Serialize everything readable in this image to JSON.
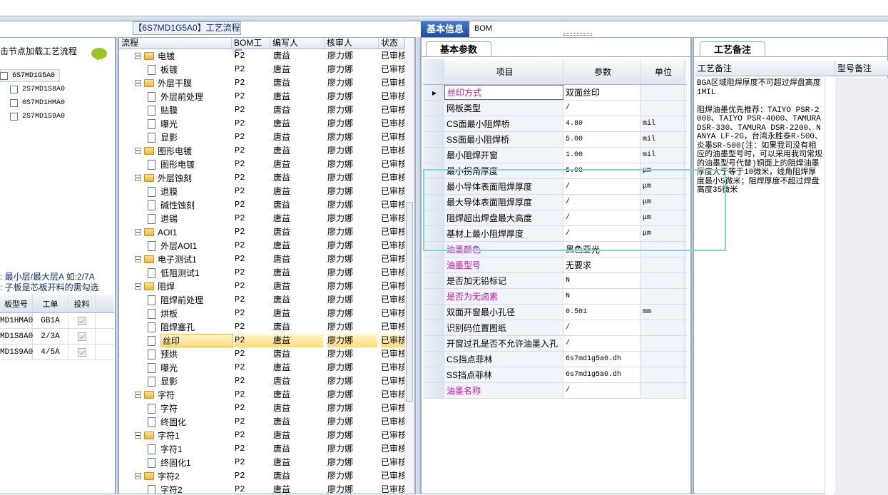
{
  "left": {
    "instruction": "击节点加载工艺流程",
    "tree": [
      "6S7MD1G5A0",
      "2S7MD1S8A0",
      "0S7MD1HMA0",
      "2S7MD1S9A0"
    ],
    "legend1": ": 最小层/最大层A 如:2/7A",
    "legend2": ": 子板是芯板开料的需勾选",
    "grid_headers": [
      "板型号",
      "工单",
      "投料"
    ],
    "grid_rows": [
      {
        "model": "MD1HMA0",
        "order": "GB1A"
      },
      {
        "model": "MD1S8A0",
        "order": "2/3A"
      },
      {
        "model": "MD1S9A0",
        "order": "4/5A"
      }
    ]
  },
  "mid": {
    "title": "【6S7MD1G5A0】工艺流程",
    "headers": [
      "流程",
      "BOM工厂",
      "编写人",
      "核审人",
      "状态"
    ],
    "rows": [
      {
        "name": "电镀",
        "type": "folder",
        "f": "P2",
        "w": "唐益",
        "r": "廖力娜",
        "s": "已审核"
      },
      {
        "name": "板镀",
        "type": "doc",
        "f": "P2",
        "w": "唐益",
        "r": "廖力娜",
        "s": "已审核"
      },
      {
        "name": "外层干膜",
        "type": "folder",
        "f": "P2",
        "w": "唐益",
        "r": "廖力娜",
        "s": "已审核"
      },
      {
        "name": "外层前处理",
        "type": "doc",
        "f": "P2",
        "w": "唐益",
        "r": "廖力娜",
        "s": "已审核"
      },
      {
        "name": "贴膜",
        "type": "doc",
        "f": "P2",
        "w": "唐益",
        "r": "廖力娜",
        "s": "已审核"
      },
      {
        "name": "曝光",
        "type": "doc",
        "f": "P2",
        "w": "唐益",
        "r": "廖力娜",
        "s": "已审核"
      },
      {
        "name": "显影",
        "type": "doc",
        "f": "P2",
        "w": "唐益",
        "r": "廖力娜",
        "s": "已审核"
      },
      {
        "name": "图形电镀",
        "type": "folder",
        "f": "P2",
        "w": "唐益",
        "r": "廖力娜",
        "s": "已审核"
      },
      {
        "name": "图形电镀",
        "type": "doc",
        "f": "P2",
        "w": "唐益",
        "r": "廖力娜",
        "s": "已审核"
      },
      {
        "name": "外层蚀刻",
        "type": "folder",
        "f": "P2",
        "w": "唐益",
        "r": "廖力娜",
        "s": "已审核"
      },
      {
        "name": "退膜",
        "type": "doc",
        "f": "P2",
        "w": "唐益",
        "r": "廖力娜",
        "s": "已审核"
      },
      {
        "name": "碱性蚀刻",
        "type": "doc",
        "f": "P2",
        "w": "唐益",
        "r": "廖力娜",
        "s": "已审核"
      },
      {
        "name": "退锡",
        "type": "doc",
        "f": "P2",
        "w": "唐益",
        "r": "廖力娜",
        "s": "已审核"
      },
      {
        "name": "AOI1",
        "type": "folder",
        "f": "P2",
        "w": "唐益",
        "r": "廖力娜",
        "s": "已审核"
      },
      {
        "name": "外层AOI1",
        "type": "doc",
        "f": "P2",
        "w": "唐益",
        "r": "廖力娜",
        "s": "已审核"
      },
      {
        "name": "电子测试1",
        "type": "folder",
        "f": "P2",
        "w": "唐益",
        "r": "廖力娜",
        "s": "已审核"
      },
      {
        "name": "低阻测试1",
        "type": "doc",
        "f": "P2",
        "w": "唐益",
        "r": "廖力娜",
        "s": "已审核"
      },
      {
        "name": "阻焊",
        "type": "folder",
        "f": "P2",
        "w": "唐益",
        "r": "廖力娜",
        "s": "已审核"
      },
      {
        "name": "阻焊前处理",
        "type": "doc",
        "f": "P2",
        "w": "唐益",
        "r": "廖力娜",
        "s": "已审核"
      },
      {
        "name": "烘板",
        "type": "doc",
        "f": "P2",
        "w": "唐益",
        "r": "廖力娜",
        "s": "已审核"
      },
      {
        "name": "阻焊塞孔",
        "type": "doc",
        "f": "P2",
        "w": "唐益",
        "r": "廖力娜",
        "s": "已审核"
      },
      {
        "name": "丝印",
        "type": "doc",
        "f": "P2",
        "w": "唐益",
        "r": "廖力娜",
        "s": "已审核",
        "sel": true
      },
      {
        "name": "预烘",
        "type": "doc",
        "f": "P2",
        "w": "唐益",
        "r": "廖力娜",
        "s": "已审核"
      },
      {
        "name": "曝光",
        "type": "doc",
        "f": "P2",
        "w": "唐益",
        "r": "廖力娜",
        "s": "已审核"
      },
      {
        "name": "显影",
        "type": "doc",
        "f": "P2",
        "w": "唐益",
        "r": "廖力娜",
        "s": "已审核"
      },
      {
        "name": "字符",
        "type": "folder",
        "f": "P2",
        "w": "唐益",
        "r": "廖力娜",
        "s": "已审核"
      },
      {
        "name": "字符",
        "type": "doc",
        "f": "P2",
        "w": "唐益",
        "r": "廖力娜",
        "s": "已审核"
      },
      {
        "name": "终固化",
        "type": "doc",
        "f": "P2",
        "w": "唐益",
        "r": "廖力娜",
        "s": "已审核"
      },
      {
        "name": "字符1",
        "type": "folder",
        "f": "P2",
        "w": "唐益",
        "r": "廖力娜",
        "s": "已审核"
      },
      {
        "name": "字符1",
        "type": "doc",
        "f": "P2",
        "w": "唐益",
        "r": "廖力娜",
        "s": "已审核"
      },
      {
        "name": "终固化1",
        "type": "doc",
        "f": "P2",
        "w": "唐益",
        "r": "廖力娜",
        "s": "已审核"
      },
      {
        "name": "字符2",
        "type": "folder",
        "f": "P2",
        "w": "唐益",
        "r": "廖力娜",
        "s": "已审核"
      },
      {
        "name": "字符2",
        "type": "doc",
        "f": "P2",
        "w": "唐益",
        "r": "廖力娜",
        "s": "已审核"
      }
    ]
  },
  "right": {
    "tab_basic": "基本信息",
    "tab_bom": "BOM",
    "subtab": "基本参数",
    "headers": [
      "项目",
      "参数",
      "单位"
    ],
    "rows": [
      {
        "item": "丝印方式",
        "param": "双面丝印",
        "unit": "",
        "pink": true
      },
      {
        "item": "网板类型",
        "param": "/",
        "unit": "",
        "pink": false
      },
      {
        "item": "CS面最小阻焊桥",
        "param": "4.80",
        "unit": "mil",
        "pink": false
      },
      {
        "item": "SS面最小阻焊桥",
        "param": "5.00",
        "unit": "mil",
        "pink": false
      },
      {
        "item": "最小阻焊开窗",
        "param": "1.00",
        "unit": "mil",
        "pink": false
      },
      {
        "item": "最小拐角厚度",
        "param": "5.00",
        "unit": "μm",
        "pink": false
      },
      {
        "item": "最小导体表面阻焊厚度",
        "param": "/",
        "unit": "μm",
        "pink": false
      },
      {
        "item": "最大导体表面阻焊厚度",
        "param": "/",
        "unit": "μm",
        "pink": false
      },
      {
        "item": "阻焊超出焊盘最大高度",
        "param": "/",
        "unit": "μm",
        "pink": false
      },
      {
        "item": "基材上最小阻焊厚度",
        "param": "/",
        "unit": "μm",
        "pink": false
      },
      {
        "item": "油墨颜色",
        "param": "黑色亚光",
        "unit": "",
        "pink": true
      },
      {
        "item": "油墨型号",
        "param": "无要求",
        "unit": "",
        "pink": true
      },
      {
        "item": "是否加无铅标记",
        "param": "N",
        "unit": "",
        "pink": false
      },
      {
        "item": "是否为无卤素",
        "param": "N",
        "unit": "",
        "pink": true
      },
      {
        "item": "双面开窗最小孔径",
        "param": "0.501",
        "unit": "mm",
        "pink": false
      },
      {
        "item": "识别码位置图纸",
        "param": "/",
        "unit": "",
        "pink": false
      },
      {
        "item": "开窗过孔是否不允许油墨入孔",
        "param": "/",
        "unit": "",
        "pink": false
      },
      {
        "item": "CS挡点菲林",
        "param": "6s7md1g5a0.dh",
        "unit": "",
        "pink": false
      },
      {
        "item": "SS挡点菲林",
        "param": "6s7md1g5a0.dh",
        "unit": "",
        "pink": false
      },
      {
        "item": "油墨名称",
        "param": "/",
        "unit": "",
        "pink": true
      }
    ]
  },
  "notes": {
    "tab": "工艺备注",
    "col1": "工艺备注",
    "col2": "型号备注",
    "text": "BGA区域阻焊厚度不可超过焊盘高度1MIL\n\n阻焊油墨优先推荐：TAIYO PSR-2000、TAIYO PSR-4000、TAMURA DSR-330、TAMURA DSR-2200、NANYA LF-2G，台湾永胜泰R-500、炎墨SR-500(注：如果我司没有相应的油墨型号时，可以采用我司常规的油墨型号代替)铜面上的阻焊油墨厚度大于等于10微米，线角阻焊厚度最小5微米；阻焊厚度不超过焊盘高度35微米"
  }
}
